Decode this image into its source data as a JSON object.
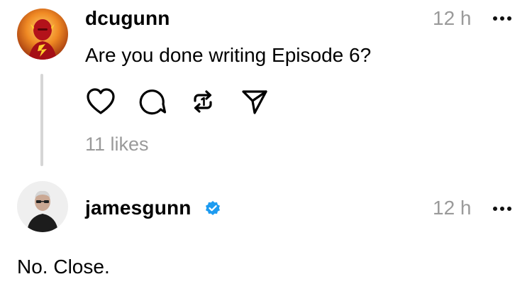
{
  "posts": [
    {
      "username": "dcugunn",
      "time": "12 h",
      "text": "Are you done writing Episode 6?",
      "likes": "11 likes",
      "avatar": "flash-avatar",
      "actions": [
        "heart-icon",
        "comment-icon",
        "repost-icon",
        "share-icon"
      ]
    },
    {
      "username": "jamesgunn",
      "verified": true,
      "time": "12 h",
      "text": "No. Close.",
      "avatar": "person-avatar"
    }
  ],
  "colors": {
    "text": "#000000",
    "muted": "#9a9a9a",
    "thread_line": "#d6d6d6",
    "verified": "#1d9bf0"
  }
}
